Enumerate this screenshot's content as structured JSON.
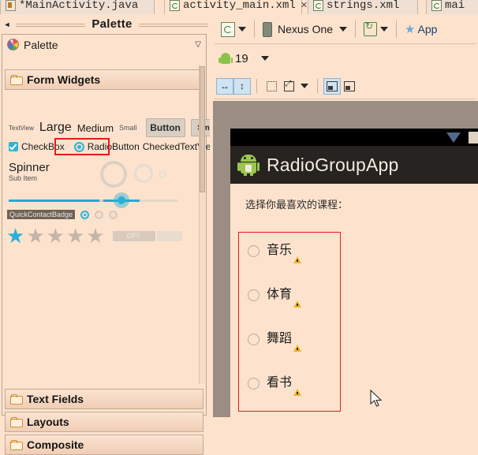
{
  "tabs": [
    {
      "label": "*MainActivity.java",
      "icon": "java-file-icon",
      "active": false,
      "closable": false
    },
    {
      "label": "activity_main.xml",
      "icon": "xml-file-icon",
      "active": true,
      "closable": true,
      "close": "✕"
    },
    {
      "label": "strings.xml",
      "icon": "xml-file-icon",
      "active": false,
      "closable": false
    },
    {
      "label": "mai",
      "icon": "xml-file-icon",
      "active": false,
      "closable": false
    }
  ],
  "palette": {
    "view_title": "Palette",
    "header_label": "Palette",
    "header_icon": "palette-icon",
    "collapse_icon": "chevron-down-icon",
    "back_arrow": "◄",
    "groups": [
      {
        "label": "Form Widgets",
        "icon": "folder-icon",
        "expanded": true
      },
      {
        "label": "Text Fields",
        "icon": "folder-icon",
        "expanded": false
      },
      {
        "label": "Layouts",
        "icon": "folder-icon",
        "expanded": false
      },
      {
        "label": "Composite",
        "icon": "folder-icon",
        "expanded": false
      }
    ],
    "widgets": {
      "textview": "TextView",
      "large": "Large",
      "medium": "Medium",
      "small_text": "Small",
      "button": "Button",
      "small_button": "Small",
      "off_button": "OFF",
      "checkbox": "CheckBox",
      "radiobutton": "RadioButton",
      "checkedtextview": "CheckedTextView",
      "spinner": "Spinner",
      "spinner_sub": "Sub Item",
      "quickcontactbadge": "QuickContactBadge",
      "switch_off": "OFF"
    },
    "selection_highlight_color": "#e51a1a"
  },
  "toolbar": {
    "config_icon": "configuration-icon",
    "device_icon": "device-icon",
    "device_name": "Nexus One",
    "orientation_icon": "rotate-icon",
    "theme_icon": "theme-star-icon",
    "theme_name": "App",
    "api_icon": "android-icon",
    "api_level": "19",
    "dropdown_icon": "chevron-down-icon",
    "buttons": [
      {
        "name": "match-width-button",
        "icon": "horizontal-arrows-icon",
        "selected": true
      },
      {
        "name": "match-height-button",
        "icon": "vertical-arrows-icon",
        "selected": true
      },
      {
        "name": "marquee-select-button",
        "icon": "dotted-square-icon",
        "selected": false
      },
      {
        "name": "zoom-fit-button",
        "icon": "expand-icon",
        "selected": false
      },
      {
        "name": "zoom-dropdown",
        "icon": "chevron-down-icon",
        "selected": false
      },
      {
        "name": "align-bottom-button",
        "icon": "align-icon",
        "selected": true
      },
      {
        "name": "distribute-button",
        "icon": "distribute-icon",
        "selected": false
      }
    ]
  },
  "preview": {
    "statusbar": {
      "signal_icon": "signal-triangle-icon",
      "battery_icon": "battery-icon"
    },
    "app_icon": "android-robot-icon",
    "app_title": "RadioGroupApp",
    "prompt": "选择你最喜欢的课程：",
    "radio_group_border_color": "#e51a1a",
    "radio_items": [
      {
        "label": "音乐",
        "checked": false,
        "warning": true,
        "warning_icon": "warning-triangle-icon"
      },
      {
        "label": "体育",
        "checked": false,
        "warning": true,
        "warning_icon": "warning-triangle-icon"
      },
      {
        "label": "舞蹈",
        "checked": false,
        "warning": true,
        "warning_icon": "warning-triangle-icon"
      },
      {
        "label": "看书",
        "checked": false,
        "warning": true,
        "warning_icon": "warning-triangle-icon"
      }
    ]
  },
  "cursor": {
    "icon": "mouse-pointer-icon"
  }
}
